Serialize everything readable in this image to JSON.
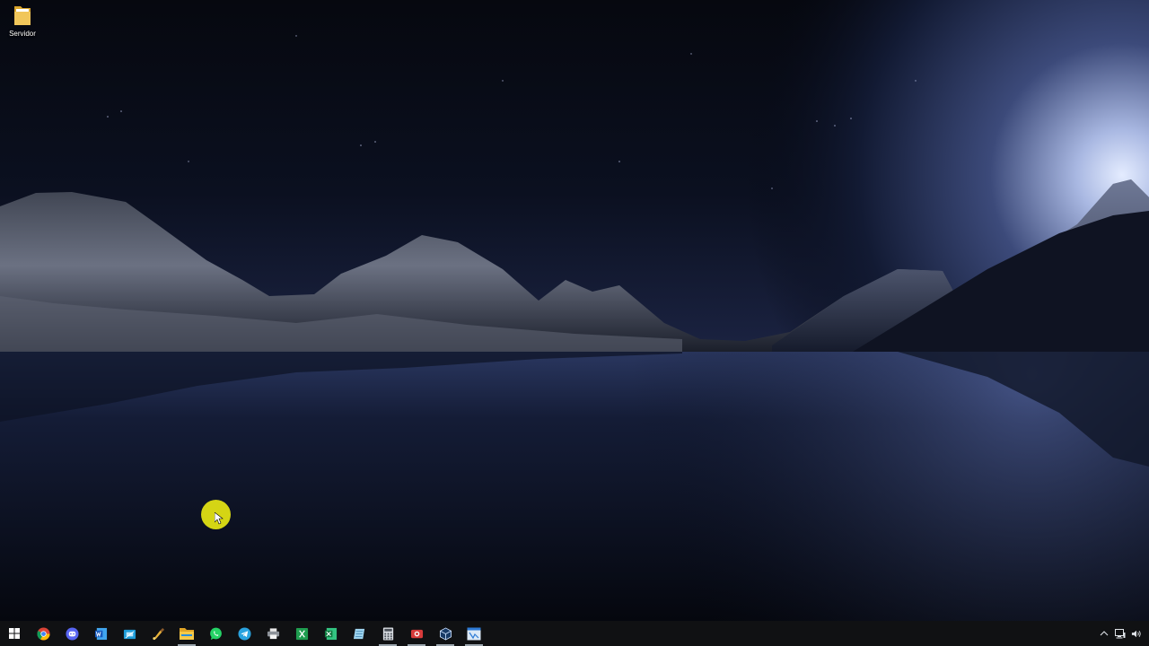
{
  "desktop": {
    "icons": [
      {
        "label": "Servidor",
        "icon": "folder-icon"
      }
    ]
  },
  "taskbar": {
    "start": {
      "icon": "windows-logo-icon"
    },
    "apps": [
      {
        "name": "chrome",
        "icon": "chrome-icon",
        "running": false
      },
      {
        "name": "discord",
        "icon": "discord-icon",
        "running": false
      },
      {
        "name": "word",
        "icon": "word-icon",
        "running": false
      },
      {
        "name": "snipping",
        "icon": "snip-icon",
        "running": false
      },
      {
        "name": "paint",
        "icon": "paint-brush-icon",
        "running": false
      },
      {
        "name": "file-explorer",
        "icon": "folder-icon",
        "running": true
      },
      {
        "name": "whatsapp",
        "icon": "whatsapp-icon",
        "running": false
      },
      {
        "name": "telegram",
        "icon": "telegram-icon",
        "running": false
      },
      {
        "name": "printer",
        "icon": "printer-icon",
        "running": false
      },
      {
        "name": "excel-green",
        "icon": "spreadsheet-icon",
        "running": false
      },
      {
        "name": "excel",
        "icon": "excel-icon",
        "running": false
      },
      {
        "name": "notes",
        "icon": "notes-icon",
        "running": false
      },
      {
        "name": "calculator",
        "icon": "calculator-icon",
        "running": true
      },
      {
        "name": "recorder",
        "icon": "record-icon",
        "running": true
      },
      {
        "name": "virtualbox",
        "icon": "cube-icon",
        "running": true
      },
      {
        "name": "remote",
        "icon": "window-app-icon",
        "running": true
      }
    ],
    "tray": [
      {
        "icon": "chevron-up-icon"
      },
      {
        "icon": "network-icon"
      },
      {
        "icon": "volume-icon"
      }
    ]
  },
  "colors": {
    "taskbar": "#101113",
    "cursor_highlight": "#e6e614",
    "running_indicator": "#9aa4ad"
  }
}
